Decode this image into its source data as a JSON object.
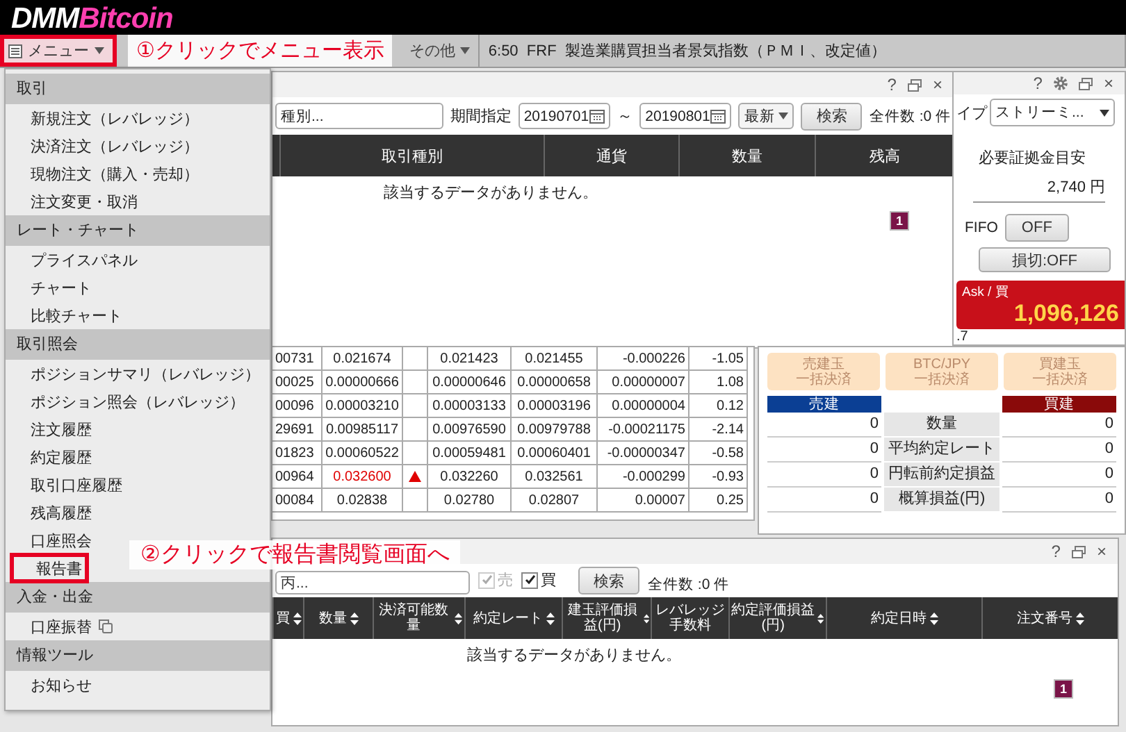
{
  "app": {
    "logo_primary": "DMM",
    "logo_secondary": "Bitcoin"
  },
  "toolbar": {
    "menu_button": {
      "label": "メニュー",
      "highlighted": true
    },
    "other_menu": "その他",
    "news": "6:50  FRF  製造業購買担当者景気指数（ＰＭＩ、改定値）"
  },
  "callouts": [
    {
      "text": "①クリックでメニュー表示"
    },
    {
      "text": "②クリックで報告書閲覧画面へ"
    }
  ],
  "menu": [
    {
      "title": "取引",
      "items": [
        {
          "label": "新規注文（レバレッジ）",
          "highlighted": false,
          "external": false
        },
        {
          "label": "決済注文（レバレッジ）",
          "highlighted": false,
          "external": false
        },
        {
          "label": "現物注文（購入・売却）",
          "highlighted": false,
          "external": false
        },
        {
          "label": "注文変更・取消",
          "highlighted": false,
          "external": false
        }
      ]
    },
    {
      "title": "レート・チャート",
      "items": [
        {
          "label": "プライスパネル",
          "highlighted": false,
          "external": false
        },
        {
          "label": "チャート",
          "highlighted": false,
          "external": false
        },
        {
          "label": "比較チャート",
          "highlighted": false,
          "external": false
        }
      ]
    },
    {
      "title": "取引照会",
      "items": [
        {
          "label": "ポジションサマリ（レバレッジ）",
          "highlighted": false,
          "external": false
        },
        {
          "label": "ポジション照会（レバレッジ）",
          "highlighted": false,
          "external": false
        },
        {
          "label": "注文履歴",
          "highlighted": false,
          "external": false
        },
        {
          "label": "約定履歴",
          "highlighted": false,
          "external": false
        },
        {
          "label": "取引口座履歴",
          "highlighted": false,
          "external": false
        },
        {
          "label": "残高履歴",
          "highlighted": false,
          "external": false
        },
        {
          "label": "口座照会",
          "highlighted": false,
          "external": false
        },
        {
          "label": "報告書",
          "highlighted": true,
          "external": false
        }
      ]
    },
    {
      "title": "入金・出金",
      "items": [
        {
          "label": "口座振替",
          "highlighted": false,
          "external": true
        }
      ]
    },
    {
      "title": "情報ツール",
      "items": [
        {
          "label": "お知らせ",
          "highlighted": false,
          "external": false
        }
      ]
    }
  ],
  "history_window": {
    "controls": [
      {
        "kind": "help",
        "text": "?"
      },
      {
        "kind": "restore"
      },
      {
        "kind": "close",
        "text": "×"
      }
    ],
    "filter": {
      "type_field": "種別...",
      "period_label": "期間指定",
      "date_from": "20190701",
      "separator": "～",
      "date_to": "20190801",
      "sort_select": "最新",
      "search_button": "検索",
      "count": "全件数 :0 件"
    },
    "columns": [
      "取引種別",
      "通貨",
      "数量",
      "残高"
    ],
    "empty_message": "該当するデータがありません。",
    "page": "1"
  },
  "rate_table": {
    "rows": [
      {
        "cells": [
          "00731",
          "0.021674",
          "0.021423",
          "0.021455",
          "-0.000226",
          "-1.05"
        ],
        "rising": false
      },
      {
        "cells": [
          "00025",
          "0.00000666",
          "0.00000646",
          "0.00000658",
          "0.00000007",
          "1.08"
        ],
        "rising": false
      },
      {
        "cells": [
          "00096",
          "0.00003210",
          "0.00003133",
          "0.00003196",
          "0.00000004",
          "0.12"
        ],
        "rising": false
      },
      {
        "cells": [
          "29691",
          "0.00985117",
          "0.00976590",
          "0.00979788",
          "-0.00021175",
          "-2.14"
        ],
        "rising": false
      },
      {
        "cells": [
          "01823",
          "0.00060522",
          "0.00059481",
          "0.00060401",
          "-0.00000347",
          "-0.58"
        ],
        "rising": false
      },
      {
        "cells": [
          "00964",
          "0.032600",
          "0.032260",
          "0.032561",
          "-0.000299",
          "-0.93"
        ],
        "rising": true
      },
      {
        "cells": [
          "00084",
          "0.02838",
          "0.02780",
          "0.02807",
          "0.00007",
          "0.25"
        ],
        "rising": false
      }
    ]
  },
  "order_panel": {
    "controls": [
      {
        "kind": "help",
        "text": "?"
      },
      {
        "kind": "settings"
      },
      {
        "kind": "restore"
      },
      {
        "kind": "close",
        "text": "×"
      }
    ],
    "type_label": "イプ",
    "type_select": "ストリーミ...",
    "margin_label": "必要証拠金目安",
    "margin_value": "2,740 円",
    "fifo_label": "FIFO",
    "fifo_button": "OFF",
    "stop_button": "損切:OFF",
    "ask_label": "Ask / 買",
    "ask_price": "1,096,126",
    "spread_fragment": ".7"
  },
  "position": {
    "buttons": [
      {
        "line1": "売建玉",
        "line2": "一括決済",
        "disabled": true
      },
      {
        "line1": "BTC/JPY",
        "line2": "一括決済",
        "disabled": true
      },
      {
        "line1": "買建玉",
        "line2": "一括決済",
        "disabled": true
      }
    ],
    "sides": [
      {
        "label": "売建",
        "color": "#0b3f94"
      },
      {
        "label": "買建",
        "color": "#8a0a0a"
      }
    ],
    "rows": [
      {
        "sell": "0",
        "label": "数量",
        "buy": "0"
      },
      {
        "sell": "0",
        "label": "平均約定レート",
        "buy": "0"
      },
      {
        "sell": "0",
        "label": "円転前約定損益",
        "buy": "0"
      },
      {
        "sell": "0",
        "label": "概算損益(円)",
        "buy": "0"
      }
    ]
  },
  "trades_window": {
    "controls": [
      {
        "kind": "help",
        "text": "?"
      },
      {
        "kind": "restore"
      },
      {
        "kind": "close",
        "text": "×"
      }
    ],
    "filter": {
      "field": "丙...",
      "checkboxes": [
        {
          "label": "売",
          "checked": true,
          "disabled": true
        },
        {
          "label": "買",
          "checked": true,
          "disabled": false
        }
      ],
      "search_button": "検索",
      "count": "全件数 :0 件"
    },
    "columns": [
      {
        "label": "買",
        "sortable": true
      },
      {
        "label": "数量",
        "sortable": true
      },
      {
        "label": "決済可能数量",
        "sortable": true
      },
      {
        "label": "約定レート",
        "sortable": true
      },
      {
        "label": "建玉評価損益(円)",
        "sortable": true
      },
      {
        "label": "レバレッジ手数料",
        "sortable": false
      },
      {
        "label": "約定評価損益(円)",
        "sortable": true
      },
      {
        "label": "約定日時",
        "sortable": true
      },
      {
        "label": "注文番号",
        "sortable": true
      }
    ],
    "empty_message": "該当するデータがありません。",
    "page": "1"
  }
}
